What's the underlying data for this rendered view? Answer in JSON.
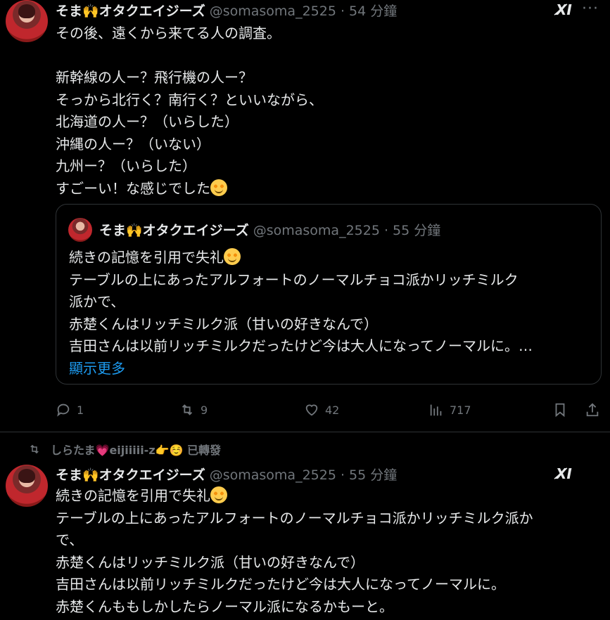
{
  "tweet1": {
    "display_name": "そま🙌オタクエイジーズ",
    "meta": "@somasoma_2525 · 54 分鐘",
    "body": "その後、遠くから来てる人の調査。\n\n新幹線の人ー？飛行機の人ー？\nそっから北行く？南行く？といいながら、\n北海道の人ー？（いらした）\n沖縄の人ー？（いない）\n九州ー？（いらした）\nすごーい！な感じでした",
    "grok_label": "X̸I",
    "more_label": "···"
  },
  "quote": {
    "display_name": "そま🙌オタクエイジーズ",
    "meta": "@somasoma_2525 · 55 分鐘",
    "line1": "続きの記憶を引用で失礼",
    "rest": "テーブルの上にあったアルフォートのノーマルチョコ派かリッチミルク\n派かで、\n赤楚くんはリッチミルク派（甘いの好きなんで）\n吉田さんは以前リッチミルクだったけど今は大人になってノーマルに。…",
    "show_more": "顯示更多"
  },
  "actions": {
    "reply_count": "1",
    "retweet_count": "9",
    "like_count": "42",
    "view_count": "717"
  },
  "retweet_banner": {
    "text": "しらたま💗eijiiiii-z👉☺️ 已轉發"
  },
  "tweet2": {
    "display_name": "そま🙌オタクエイジーズ",
    "meta": "@somasoma_2525 · 55 分鐘",
    "line1": "続きの記憶を引用で失礼",
    "rest": "テーブルの上にあったアルフォートのノーマルチョコ派かリッチミルク派か\nで、\n赤楚くんはリッチミルク派（甘いの好きなんで）\n吉田さんは以前リッチミルクだったけど今は大人になってノーマルに。\n赤楚くんももしかしたらノーマル派になるかもーと。",
    "grok_label": "X̸I"
  }
}
